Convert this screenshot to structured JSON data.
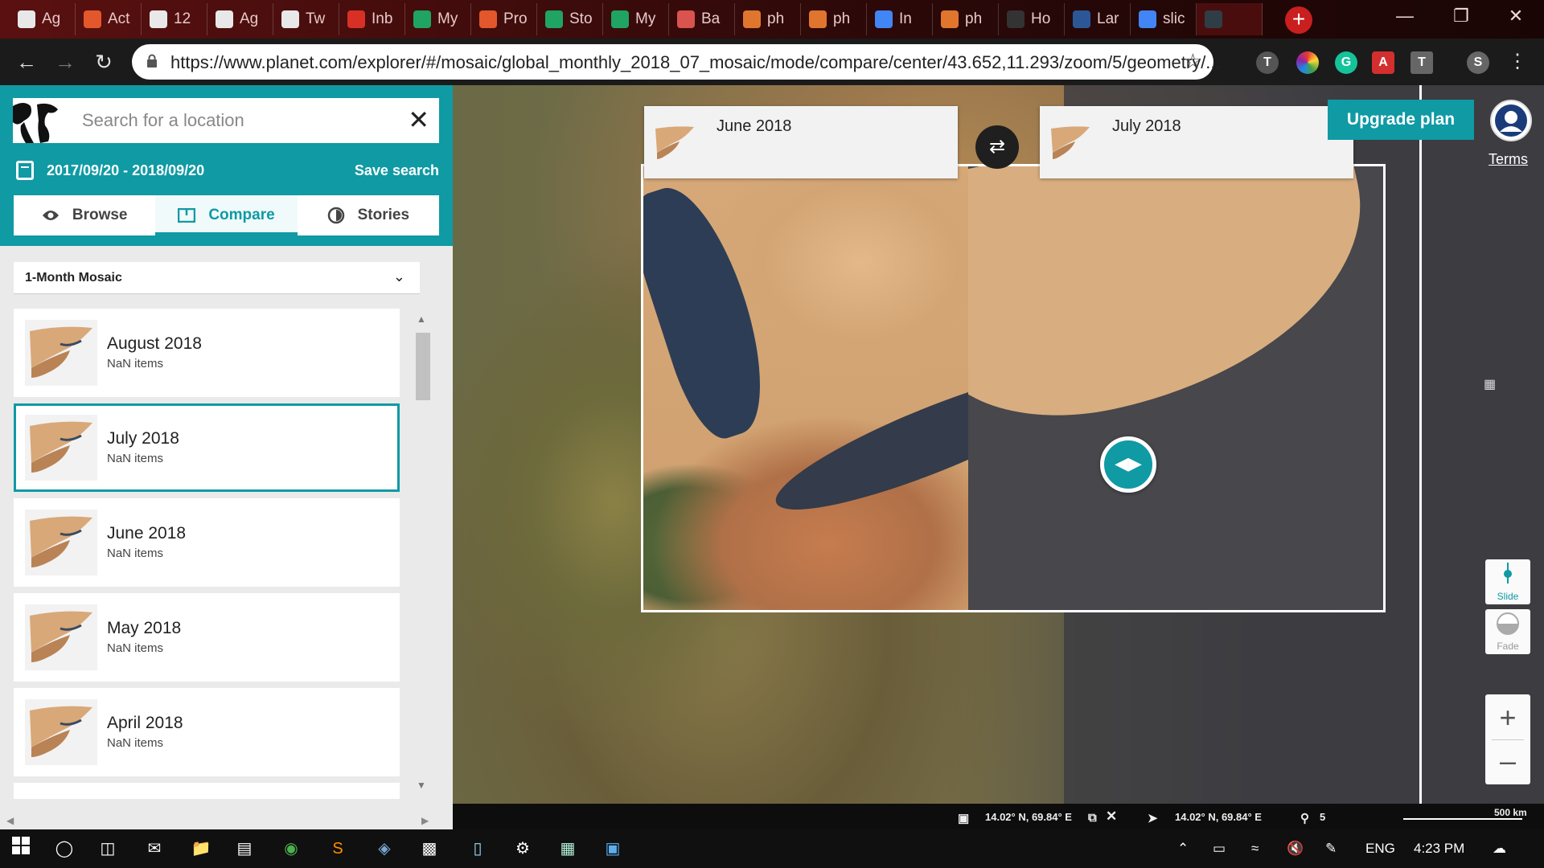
{
  "browser": {
    "tabs": [
      {
        "label": "Ag",
        "color": "#e8e8e8"
      },
      {
        "label": "Act",
        "color": "#e2572b"
      },
      {
        "label": "12",
        "color": "#e8e8e8"
      },
      {
        "label": "Ag",
        "color": "#e8e8e8"
      },
      {
        "label": "Tw",
        "color": "#e8e8e8"
      },
      {
        "label": "Inb",
        "color": "#d93025"
      },
      {
        "label": "My",
        "color": "#1fa463"
      },
      {
        "label": "Pro",
        "color": "#e2572b"
      },
      {
        "label": "Sto",
        "color": "#1fa463"
      },
      {
        "label": "My",
        "color": "#1fa463"
      },
      {
        "label": "Ba",
        "color": "#d9534f"
      },
      {
        "label": "ph",
        "color": "#e0762e"
      },
      {
        "label": "ph",
        "color": "#e0762e"
      },
      {
        "label": "In",
        "color": "#4285f4"
      },
      {
        "label": "ph",
        "color": "#e0762e"
      },
      {
        "label": "Ho",
        "color": "#333333"
      },
      {
        "label": "Lar",
        "color": "#2b5797"
      },
      {
        "label": "slic",
        "color": "#4285f4"
      },
      {
        "label": "",
        "color": "#2f3e46"
      }
    ],
    "url": "https://www.planet.com/explorer/#/mosaic/global_monthly_2018_07_mosaic/mode/compare/center/43.652,11.293/zoom/5/geometry/...",
    "profile_initial": "S"
  },
  "sidebar": {
    "search_placeholder": "Search for a location",
    "date_range": "2017/09/20 - 2018/09/20",
    "save_search": "Save search",
    "tabs": [
      {
        "label": "Browse",
        "icon": "eye-icon",
        "active": false
      },
      {
        "label": "Compare",
        "icon": "compare-icon",
        "active": true
      },
      {
        "label": "Stories",
        "icon": "stories-icon",
        "active": false
      }
    ],
    "mosaic_type": "1-Month Mosaic",
    "items": [
      {
        "title": "August 2018",
        "sub": "NaN items",
        "selected": false
      },
      {
        "title": "July 2018",
        "sub": "NaN items",
        "selected": true
      },
      {
        "title": "June 2018",
        "sub": "NaN items",
        "selected": false
      },
      {
        "title": "May 2018",
        "sub": "NaN items",
        "selected": false
      },
      {
        "title": "April 2018",
        "sub": "NaN items",
        "selected": false
      }
    ]
  },
  "map": {
    "left_card": "June 2018",
    "right_card": "July 2018",
    "upgrade": "Upgrade plan",
    "terms": "Terms",
    "mode_slide": "Slide",
    "mode_fade": "Fade",
    "status": {
      "coords_left": "14.02° N, 69.84° E",
      "coords_right": "14.02° N, 69.84° E",
      "zoom": "5",
      "scale": "500 km"
    },
    "accent": "#0f9aa4"
  },
  "taskbar": {
    "lang": "ENG",
    "time": "4:23 PM"
  }
}
